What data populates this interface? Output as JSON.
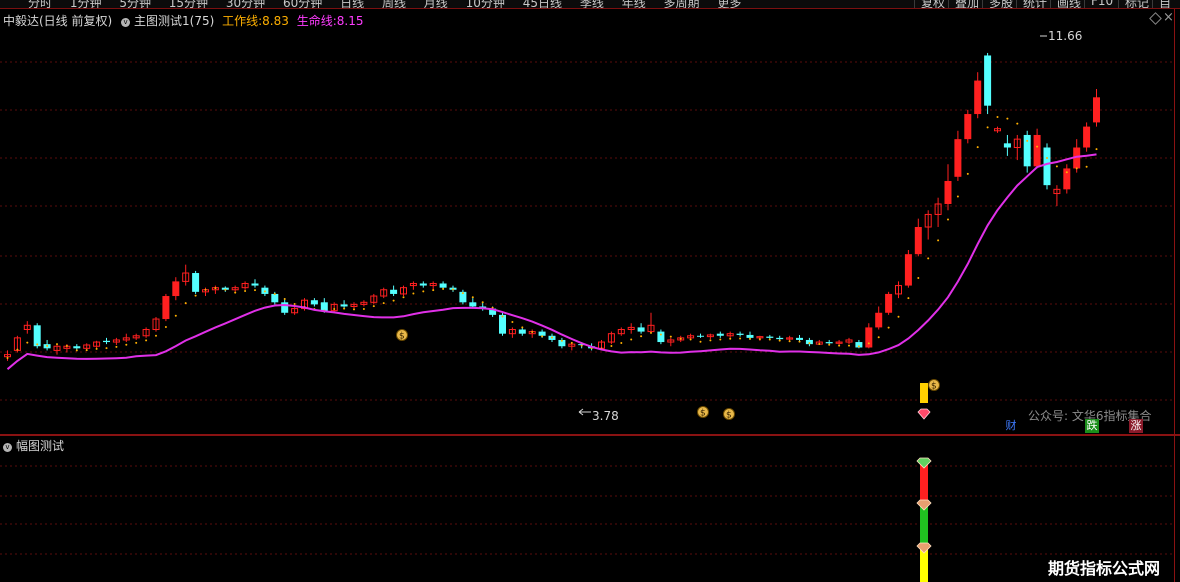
{
  "top_tabs": [
    "分时",
    "1分钟",
    "5分钟",
    "15分钟",
    "30分钟",
    "60分钟",
    "日线",
    "周线",
    "月线",
    "10分钟",
    "45日线",
    "季线",
    "年线",
    "多周期",
    "更多"
  ],
  "top_right": [
    "复权",
    "叠加",
    "多股",
    "统计",
    "画线",
    "F10",
    "标记",
    "自选"
  ],
  "main_header": {
    "stock": "中毅达(日线 前复权)",
    "indicator": "主图测试1(75)",
    "work_label": "工作线:",
    "work_value": "8.83",
    "life_label": "生命线:",
    "life_value": "8.15"
  },
  "sub_header": {
    "indicator": "幅图测试"
  },
  "annotations": {
    "high": "11.66",
    "low": "3.78",
    "gzh": "公众号: 文华6指标集合",
    "cai": "财",
    "die": "跌",
    "zhang": "涨"
  },
  "watermark": "期货指标公式网",
  "colors": {
    "up": "#ff2020",
    "down": "#54ffff",
    "life": "#e030e8",
    "work_dots": "#ffb000",
    "grid": "#8a1212"
  },
  "chart_data": {
    "type": "candlestick",
    "ylim": [
      2.6,
      12.4
    ],
    "candles": [
      [
        4.4,
        4.55,
        4.3,
        4.45
      ],
      [
        4.55,
        4.9,
        4.5,
        4.85
      ],
      [
        5.05,
        5.25,
        4.95,
        5.15
      ],
      [
        5.15,
        5.2,
        4.6,
        4.65
      ],
      [
        4.7,
        4.8,
        4.55,
        4.6
      ],
      [
        4.55,
        4.7,
        4.45,
        4.65
      ],
      [
        4.6,
        4.7,
        4.5,
        4.65
      ],
      [
        4.65,
        4.7,
        4.55,
        4.6
      ],
      [
        4.6,
        4.72,
        4.55,
        4.68
      ],
      [
        4.65,
        4.78,
        4.6,
        4.75
      ],
      [
        4.78,
        4.85,
        4.7,
        4.75
      ],
      [
        4.75,
        4.85,
        4.68,
        4.8
      ],
      [
        4.8,
        4.95,
        4.75,
        4.85
      ],
      [
        4.85,
        4.95,
        4.8,
        4.9
      ],
      [
        4.9,
        5.1,
        4.85,
        5.05
      ],
      [
        5.05,
        5.35,
        5.0,
        5.3
      ],
      [
        5.3,
        5.9,
        5.25,
        5.85
      ],
      [
        5.85,
        6.3,
        5.75,
        6.2
      ],
      [
        6.2,
        6.6,
        6.1,
        6.4
      ],
      [
        6.4,
        6.45,
        5.9,
        5.95
      ],
      [
        5.95,
        6.05,
        5.85,
        6.0
      ],
      [
        6.0,
        6.1,
        5.9,
        6.05
      ],
      [
        6.05,
        6.08,
        5.95,
        6.0
      ],
      [
        6.0,
        6.1,
        5.95,
        6.05
      ],
      [
        6.05,
        6.2,
        6.0,
        6.15
      ],
      [
        6.15,
        6.25,
        6.05,
        6.1
      ],
      [
        6.05,
        6.1,
        5.85,
        5.9
      ],
      [
        5.9,
        5.95,
        5.65,
        5.7
      ],
      [
        5.7,
        5.8,
        5.4,
        5.45
      ],
      [
        5.45,
        5.6,
        5.4,
        5.55
      ],
      [
        5.55,
        5.8,
        5.5,
        5.75
      ],
      [
        5.75,
        5.8,
        5.6,
        5.65
      ],
      [
        5.7,
        5.8,
        5.45,
        5.5
      ],
      [
        5.5,
        5.7,
        5.45,
        5.65
      ],
      [
        5.65,
        5.75,
        5.55,
        5.6
      ],
      [
        5.6,
        5.7,
        5.55,
        5.65
      ],
      [
        5.65,
        5.75,
        5.6,
        5.7
      ],
      [
        5.7,
        5.9,
        5.65,
        5.85
      ],
      [
        5.85,
        6.05,
        5.8,
        6.0
      ],
      [
        6.0,
        6.1,
        5.85,
        5.9
      ],
      [
        5.9,
        6.1,
        5.85,
        6.05
      ],
      [
        6.1,
        6.2,
        6.0,
        6.15
      ],
      [
        6.15,
        6.2,
        6.05,
        6.1
      ],
      [
        6.1,
        6.2,
        6.0,
        6.15
      ],
      [
        6.15,
        6.2,
        6.0,
        6.05
      ],
      [
        6.05,
        6.1,
        5.95,
        6.0
      ],
      [
        5.95,
        6.0,
        5.65,
        5.7
      ],
      [
        5.7,
        5.8,
        5.55,
        5.6
      ],
      [
        5.6,
        5.7,
        5.5,
        5.55
      ],
      [
        5.55,
        5.6,
        5.35,
        5.4
      ],
      [
        5.4,
        5.45,
        4.9,
        4.95
      ],
      [
        4.95,
        5.1,
        4.85,
        5.05
      ],
      [
        5.05,
        5.1,
        4.9,
        4.95
      ],
      [
        4.95,
        5.05,
        4.85,
        5.0
      ],
      [
        5.0,
        5.05,
        4.85,
        4.9
      ],
      [
        4.9,
        4.95,
        4.75,
        4.8
      ],
      [
        4.8,
        4.85,
        4.6,
        4.65
      ],
      [
        4.65,
        4.75,
        4.55,
        4.7
      ],
      [
        4.7,
        4.75,
        4.6,
        4.68
      ],
      [
        4.65,
        4.72,
        4.55,
        4.6
      ],
      [
        4.6,
        4.8,
        4.55,
        4.75
      ],
      [
        4.75,
        5.0,
        4.7,
        4.95
      ],
      [
        4.95,
        5.1,
        4.9,
        5.05
      ],
      [
        5.05,
        5.2,
        4.95,
        5.1
      ],
      [
        5.1,
        5.2,
        4.95,
        5.0
      ],
      [
        5.0,
        5.45,
        4.95,
        5.15
      ],
      [
        5.0,
        5.05,
        4.7,
        4.75
      ],
      [
        4.75,
        4.85,
        4.65,
        4.8
      ],
      [
        4.8,
        4.9,
        4.75,
        4.85
      ],
      [
        4.85,
        4.95,
        4.8,
        4.9
      ],
      [
        4.9,
        4.95,
        4.85,
        4.88
      ],
      [
        4.88,
        4.95,
        4.82,
        4.92
      ],
      [
        4.95,
        5.0,
        4.85,
        4.9
      ],
      [
        4.9,
        5.0,
        4.85,
        4.95
      ],
      [
        4.95,
        5.0,
        4.88,
        4.92
      ],
      [
        4.92,
        5.0,
        4.8,
        4.85
      ],
      [
        4.85,
        4.9,
        4.78,
        4.88
      ],
      [
        4.88,
        4.92,
        4.82,
        4.85
      ],
      [
        4.85,
        4.9,
        4.78,
        4.82
      ],
      [
        4.82,
        4.9,
        4.78,
        4.85
      ],
      [
        4.85,
        4.92,
        4.75,
        4.8
      ],
      [
        4.8,
        4.85,
        4.65,
        4.7
      ],
      [
        4.7,
        4.8,
        4.68,
        4.75
      ],
      [
        4.75,
        4.8,
        4.7,
        4.72
      ],
      [
        4.72,
        4.8,
        4.68,
        4.75
      ],
      [
        4.75,
        4.85,
        4.7,
        4.8
      ],
      [
        4.75,
        4.8,
        4.6,
        4.62
      ],
      [
        4.62,
        5.2,
        4.6,
        5.1
      ],
      [
        5.1,
        5.6,
        5.05,
        5.45
      ],
      [
        5.45,
        5.95,
        5.4,
        5.9
      ],
      [
        5.9,
        6.2,
        5.8,
        6.1
      ],
      [
        6.1,
        6.95,
        6.05,
        6.85
      ],
      [
        6.85,
        7.7,
        6.8,
        7.5
      ],
      [
        7.5,
        7.9,
        7.2,
        7.8
      ],
      [
        7.8,
        8.2,
        7.5,
        8.05
      ],
      [
        8.05,
        9.0,
        7.9,
        8.6
      ],
      [
        8.7,
        9.8,
        8.6,
        9.6
      ],
      [
        9.6,
        10.3,
        9.5,
        10.2
      ],
      [
        10.2,
        11.2,
        10.1,
        11.0
      ],
      [
        11.6,
        11.66,
        10.2,
        10.4
      ],
      [
        9.8,
        9.9,
        9.75,
        9.85
      ],
      [
        9.5,
        9.7,
        9.2,
        9.4
      ],
      [
        9.4,
        9.7,
        9.1,
        9.6
      ],
      [
        9.7,
        9.8,
        8.8,
        8.95
      ],
      [
        8.95,
        9.85,
        8.9,
        9.7
      ],
      [
        9.4,
        9.5,
        8.4,
        8.5
      ],
      [
        8.3,
        8.5,
        8.0,
        8.4
      ],
      [
        8.4,
        9.0,
        8.3,
        8.9
      ],
      [
        8.9,
        9.6,
        8.8,
        9.4
      ],
      [
        9.4,
        10.0,
        9.3,
        9.9
      ],
      [
        10.0,
        10.8,
        9.9,
        10.6
      ]
    ]
  }
}
